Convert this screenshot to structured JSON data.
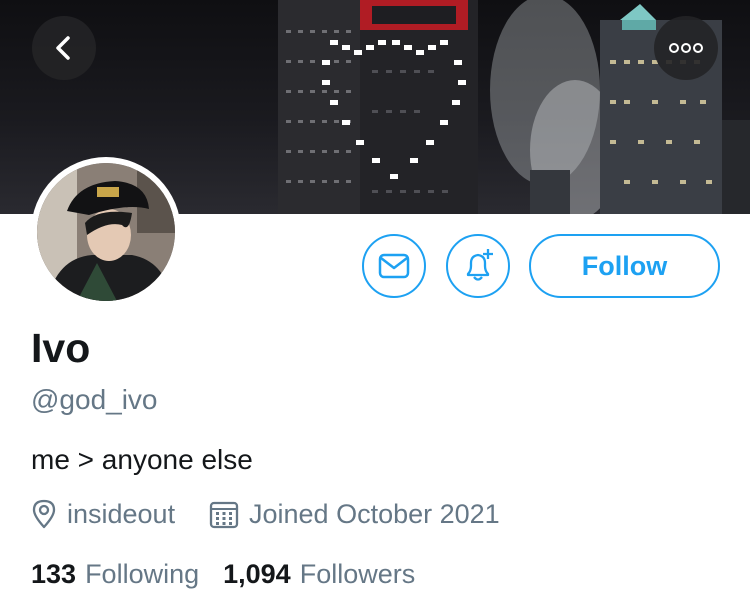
{
  "profile": {
    "name": "Ivo",
    "handle": "@god_ivo",
    "bio": "me > anyone else",
    "location": "insideout",
    "joined": "Joined October 2021"
  },
  "stats": {
    "following_count": "133",
    "following_label": "Following",
    "followers_count": "1,094",
    "followers_label": "Followers"
  },
  "actions": {
    "follow_label": "Follow"
  },
  "icons": {
    "back": "back-arrow-icon",
    "more": "more-options-icon",
    "message": "envelope-icon",
    "notify": "bell-plus-icon",
    "location": "location-pin-icon",
    "calendar": "calendar-icon"
  },
  "colors": {
    "accent": "#1da1f2",
    "secondary_text": "#657786",
    "primary_text": "#14171a"
  }
}
